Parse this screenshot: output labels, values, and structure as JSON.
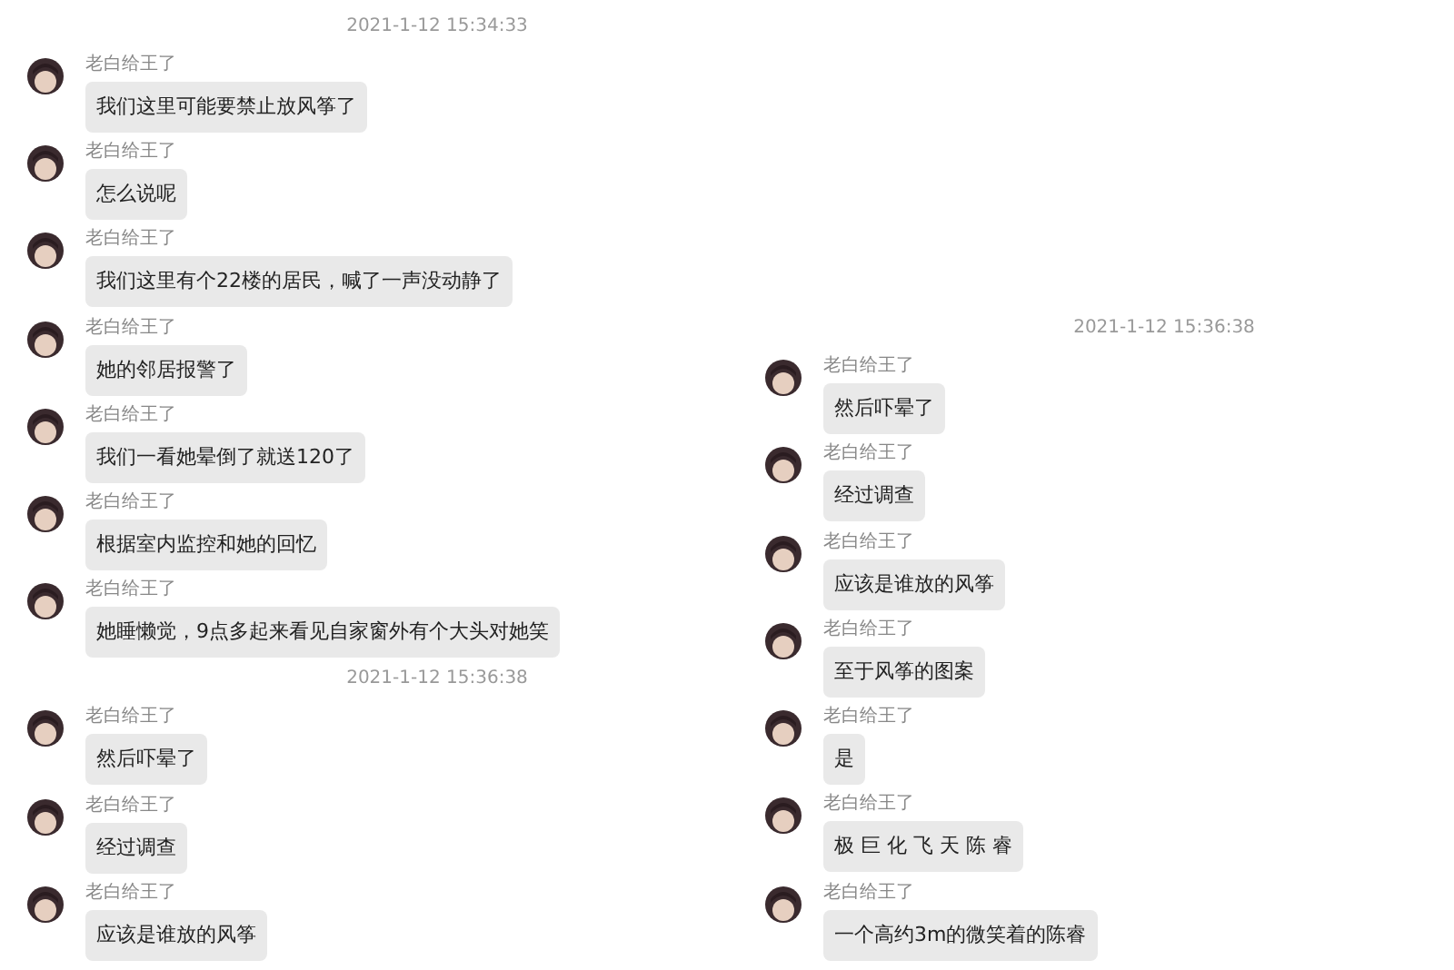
{
  "columns": [
    {
      "items": [
        {
          "kind": "time",
          "text": "2021-1-12 15:34:33"
        },
        {
          "kind": "message",
          "sender": "老白给王了",
          "text": "我们这里可能要禁止放风筝了"
        },
        {
          "kind": "message",
          "sender": "老白给王了",
          "text": "怎么说呢"
        },
        {
          "kind": "message",
          "sender": "老白给王了",
          "text": "我们这里有个22楼的居民，喊了一声没动静了"
        },
        {
          "kind": "message",
          "sender": "老白给王了",
          "text": "她的邻居报警了"
        },
        {
          "kind": "message",
          "sender": "老白给王了",
          "text": "我们一看她晕倒了就送120了"
        },
        {
          "kind": "message",
          "sender": "老白给王了",
          "text": "根据室内监控和她的回忆"
        },
        {
          "kind": "message",
          "sender": "老白给王了",
          "text": "她睡懒觉，9点多起来看见自家窗外有个大头对她笑"
        },
        {
          "kind": "time",
          "text": "2021-1-12 15:36:38"
        },
        {
          "kind": "message",
          "sender": "老白给王了",
          "text": "然后吓晕了"
        },
        {
          "kind": "message",
          "sender": "老白给王了",
          "text": "经过调查"
        },
        {
          "kind": "message",
          "sender": "老白给王了",
          "text": "应该是谁放的风筝"
        }
      ]
    },
    {
      "items": [
        {
          "kind": "time",
          "text": "2021-1-12 15:36:38"
        },
        {
          "kind": "message",
          "sender": "老白给王了",
          "text": "然后吓晕了"
        },
        {
          "kind": "message",
          "sender": "老白给王了",
          "text": "经过调查"
        },
        {
          "kind": "message",
          "sender": "老白给王了",
          "text": "应该是谁放的风筝"
        },
        {
          "kind": "message",
          "sender": "老白给王了",
          "text": "至于风筝的图案"
        },
        {
          "kind": "message",
          "sender": "老白给王了",
          "text": "是"
        },
        {
          "kind": "message",
          "sender": "老白给王了",
          "text": "极 巨 化 飞 天 陈 睿"
        },
        {
          "kind": "message",
          "sender": "老白给王了",
          "text": "一个高约3m的微笑着的陈睿"
        }
      ]
    }
  ]
}
